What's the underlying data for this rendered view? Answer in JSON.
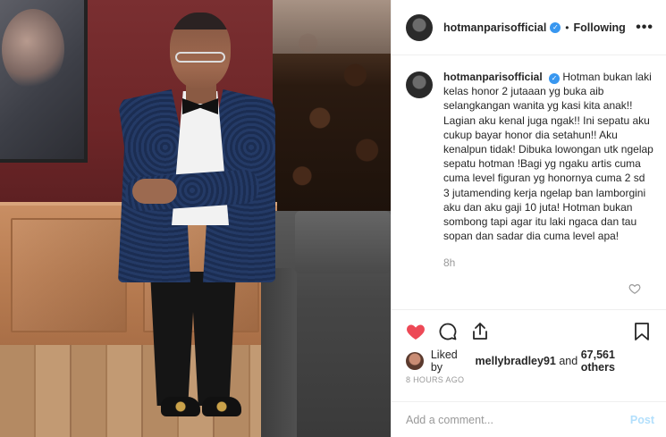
{
  "post": {
    "username": "hotmanparisofficial",
    "follow_status": "Following",
    "more_label": "•••",
    "dot": "•",
    "caption": "Hotman bukan laki kelas honor 2 jutaaan yg buka aib selangkangan wanita yg kasi kita anak!! Lagian aku kenal juga ngak!! Ini sepatu aku cukup bayar honor dia setahun!! Aku kenalpun tidak! Dibuka lowongan utk ngelap sepatu hotman !Bagi yg ngaku artis cuma cuma level figuran yg honornya cuma 2 sd 3 jutamending kerja ngelap ban lamborgini aku dan aku gaji 10 juta! Hotman bukan sombong tapi agar itu laki ngaca dan tau sopan dan sadar dia cuma level apa!",
    "caption_time": "8h",
    "verified_mark": "✓"
  },
  "likes": {
    "prefix": "Liked by",
    "first_liker": "mellybradley91",
    "connector": "and",
    "others": "67,561 others"
  },
  "posted_ago": "8 HOURS AGO",
  "comment": {
    "placeholder": "Add a comment...",
    "post_label": "Post"
  },
  "icons": {
    "like": "heart-icon-filled",
    "comment": "comment-icon",
    "share": "share-icon",
    "save": "bookmark-icon",
    "caption_like": "heart-outline-icon"
  },
  "colors": {
    "like_red": "#ed4956",
    "verified_blue": "#3897f0",
    "muted_text": "#999999",
    "post_disabled": "#b2dffc"
  }
}
